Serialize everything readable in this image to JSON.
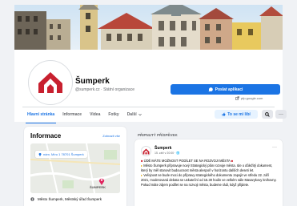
{
  "page": {
    "name": "Šumperk",
    "subtitle": "@sumperk.cz · Státní organizace",
    "send_button": "Poslat aplikaci",
    "website": "pfp.google.com"
  },
  "tabs": [
    {
      "label": "Hlavní stránka",
      "active": true
    },
    {
      "label": "Informace"
    },
    {
      "label": "Videa"
    },
    {
      "label": "Fotky"
    },
    {
      "label": "Další"
    }
  ],
  "actions": {
    "like_label": "To se mi líbí",
    "more_label": "···"
  },
  "info": {
    "title": "Informace",
    "link": "Zobrazit vše",
    "address": "nám. Míru 1 78701 Šumperk",
    "map_city": "ŠUMPERK",
    "row_text": "Město Šumperk, Městský úřad Šumperk"
  },
  "posts": {
    "section_title": "PŘIPNUTÝ PŘÍSPĚVEK",
    "author": "Šumperk",
    "meta": "15. září v 20:00 · 🌐",
    "more": "···",
    "lines": [
      "ÚDĚ MÁTE MOŽNOST PODÍLET SE NA ROZVOJI MĚSTA",
      "Město Šumperk připravuje nový Strategický plán rozvoje města. Ide o důležitý dokument, který by měl stanovit budoucnost města alespoň v horizontu dalších deseti let.",
      "Veřejnost se bude moci do přípravy strategického dokumentu zapojit ve středu 22. září 2021, moderovaná debata se uskuteční od 15.30 hodin ve velkém sále Masarykovy knihovny. Pokud máte zájem podílet se na rozvoji města, budeme rádi, když přijdete."
    ]
  },
  "colors": {
    "accent": "#1b74e4",
    "logo_red": "#c8202f"
  }
}
